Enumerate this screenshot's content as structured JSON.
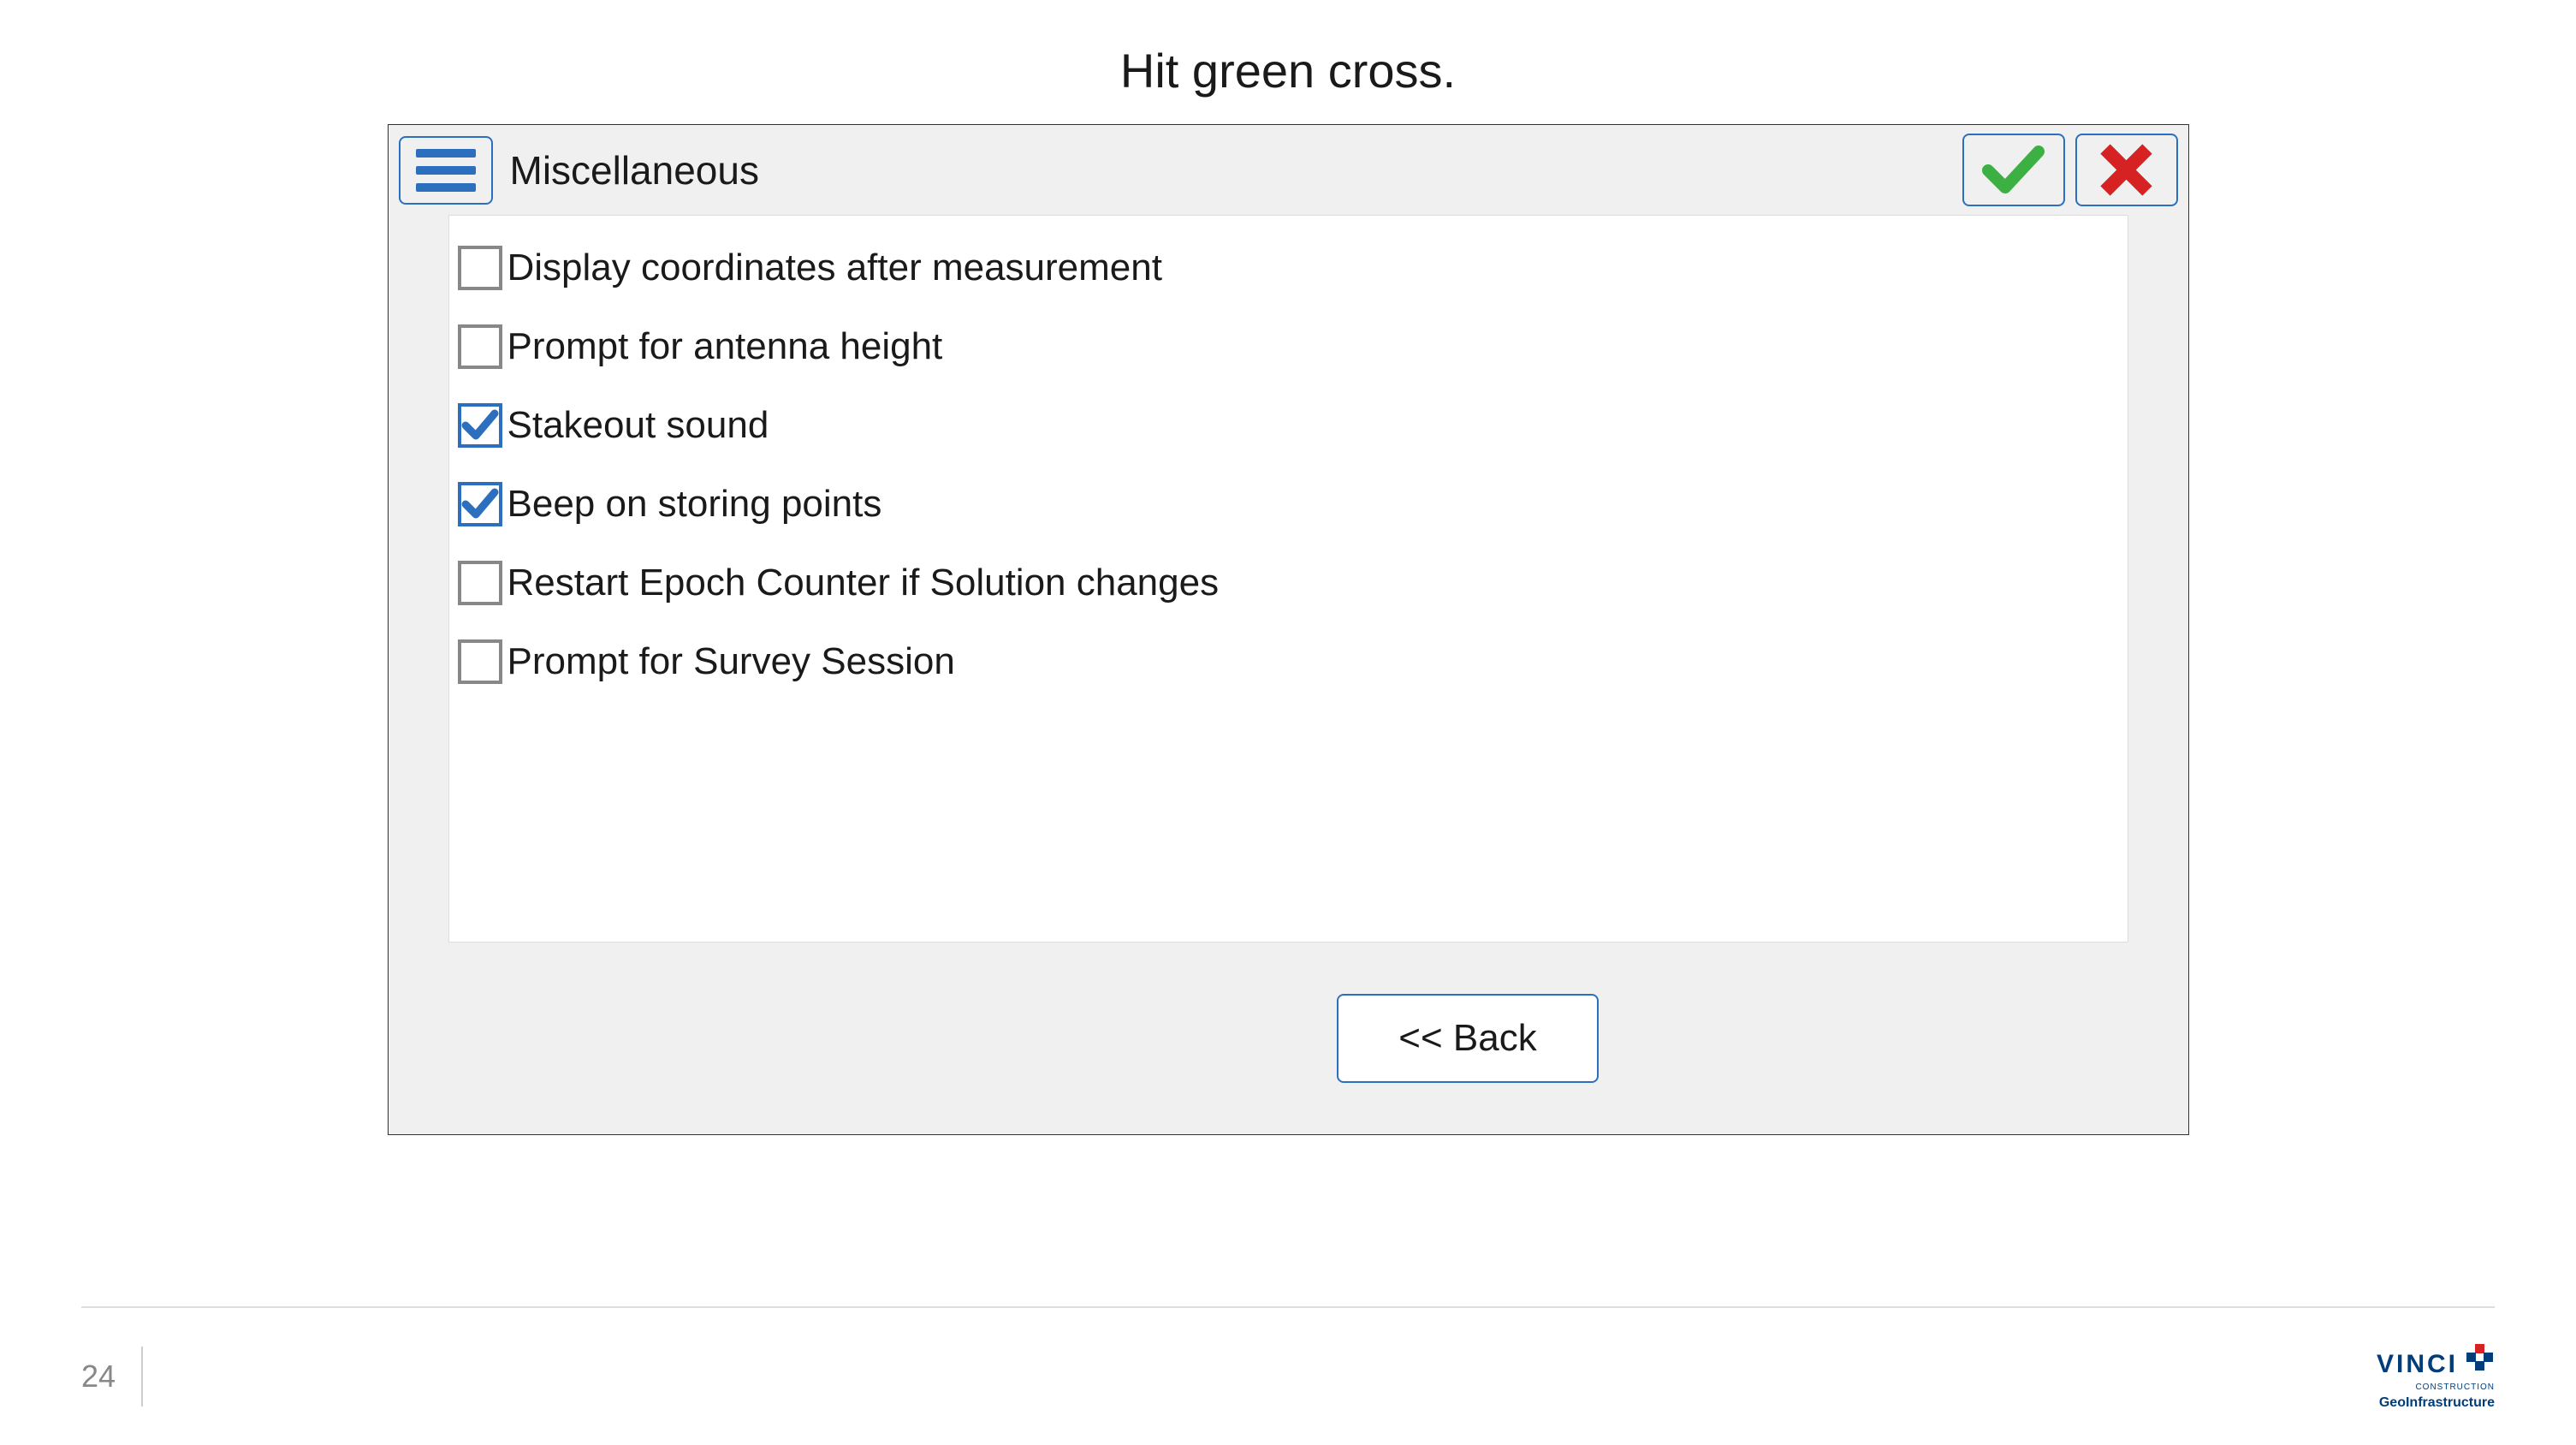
{
  "slide": {
    "title": "Hit green cross.",
    "page_number": "24"
  },
  "dialog": {
    "title": "Miscellaneous",
    "options": [
      {
        "label": "Display coordinates after measurement",
        "checked": false
      },
      {
        "label": "Prompt for antenna height",
        "checked": false
      },
      {
        "label": "Stakeout sound",
        "checked": true
      },
      {
        "label": "Beep on storing points",
        "checked": true
      },
      {
        "label": "Restart Epoch Counter if Solution changes",
        "checked": false
      },
      {
        "label": "Prompt for Survey Session",
        "checked": false
      }
    ],
    "back_label": "<< Back"
  },
  "branding": {
    "company": "VINCI",
    "division": "CONSTRUCTION",
    "subdivision": "GeoInfrastructure"
  }
}
